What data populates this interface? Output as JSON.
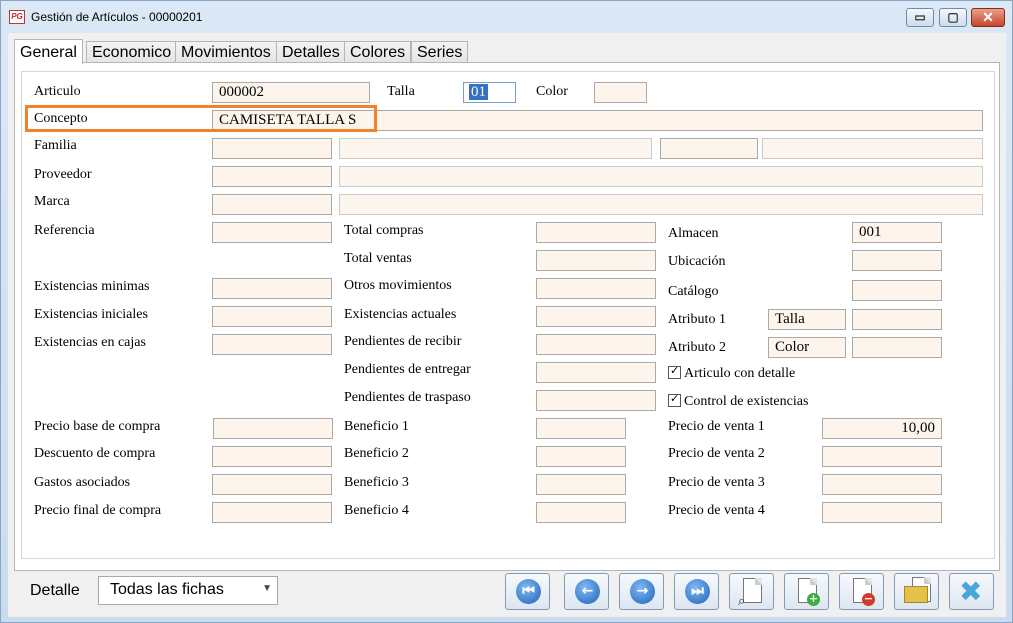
{
  "window": {
    "app_icon": "PG",
    "title": "Gestión de Artículos - 00000201",
    "minimize": "▭",
    "maximize": "▢",
    "close": "✕"
  },
  "tabs": [
    "General",
    "Economico",
    "Movimientos",
    "Detalles",
    "Colores",
    "Series"
  ],
  "form": {
    "articulo_label": "Articulo",
    "articulo_value": "000002",
    "talla_label": "Talla",
    "talla_value": "01",
    "color_label": "Color",
    "color_value": "",
    "concepto_label": "Concepto",
    "concepto_value": "CAMISETA TALLA S",
    "familia_label": "Familia",
    "proveedor_label": "Proveedor",
    "marca_label": "Marca",
    "referencia_label": "Referencia",
    "existencias_minimas_label": "Existencias minimas",
    "existencias_iniciales_label": "Existencias iniciales",
    "existencias_cajas_label": "Existencias en cajas",
    "precio_base_compra_label": "Precio base de compra",
    "descuento_compra_label": "Descuento de compra",
    "gastos_asociados_label": "Gastos asociados",
    "precio_final_compra_label": "Precio final de compra",
    "total_compras_label": "Total compras",
    "total_ventas_label": "Total ventas",
    "otros_movimientos_label": "Otros movimientos",
    "existencias_actuales_label": "Existencias actuales",
    "pendientes_recibir_label": "Pendientes de recibir",
    "pendientes_entregar_label": "Pendientes de entregar",
    "pendientes_traspaso_label": "Pendientes de traspaso",
    "beneficio1_label": "Beneficio 1",
    "beneficio2_label": "Beneficio 2",
    "beneficio3_label": "Beneficio 3",
    "beneficio4_label": "Beneficio 4",
    "almacen_label": "Almacen",
    "almacen_value": "001",
    "ubicacion_label": "Ubicación",
    "catalogo_label": "Catálogo",
    "atributo1_label": "Atributo 1",
    "atributo1_name": "Talla",
    "atributo2_label": "Atributo 2",
    "atributo2_name": "Color",
    "articulo_con_detalle_label": "Articulo con detalle",
    "control_existencias_label": "Control de existencias",
    "precio_venta1_label": "Precio de venta 1",
    "precio_venta1_value": "10,00",
    "precio_venta2_label": "Precio de venta 2",
    "precio_venta3_label": "Precio de venta 3",
    "precio_venta4_label": "Precio de venta 4"
  },
  "footer": {
    "detalle_label": "Detalle",
    "detalle_selected": "Todas las fichas",
    "dropdown_arrow": "▼",
    "first": "⏮",
    "prev": "←",
    "next": "→",
    "last": "⏭",
    "search_glyph": "⌕",
    "add_glyph": "+",
    "delete_glyph": "−",
    "close_glyph": "✖"
  },
  "colors": {
    "highlight": "#f0822c",
    "field_bg": "#fdf5ec",
    "accent": "#1f63b7"
  }
}
